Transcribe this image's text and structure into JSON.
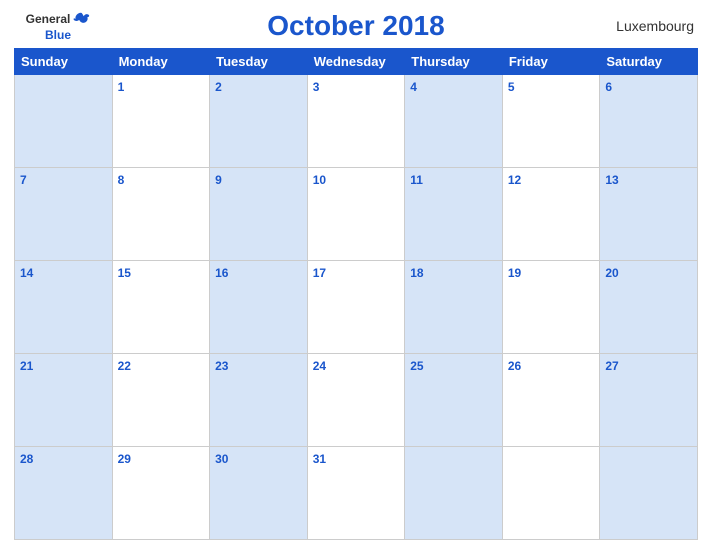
{
  "header": {
    "logo_general": "General",
    "logo_blue": "Blue",
    "title": "October 2018",
    "country": "Luxembourg"
  },
  "weekdays": [
    "Sunday",
    "Monday",
    "Tuesday",
    "Wednesday",
    "Thursday",
    "Friday",
    "Saturday"
  ],
  "weeks": [
    [
      {
        "day": "",
        "bg": "blue"
      },
      {
        "day": "1",
        "bg": "white"
      },
      {
        "day": "2",
        "bg": "blue"
      },
      {
        "day": "3",
        "bg": "white"
      },
      {
        "day": "4",
        "bg": "blue"
      },
      {
        "day": "5",
        "bg": "white"
      },
      {
        "day": "6",
        "bg": "blue"
      }
    ],
    [
      {
        "day": "7",
        "bg": "blue"
      },
      {
        "day": "8",
        "bg": "white"
      },
      {
        "day": "9",
        "bg": "blue"
      },
      {
        "day": "10",
        "bg": "white"
      },
      {
        "day": "11",
        "bg": "blue"
      },
      {
        "day": "12",
        "bg": "white"
      },
      {
        "day": "13",
        "bg": "blue"
      }
    ],
    [
      {
        "day": "14",
        "bg": "blue"
      },
      {
        "day": "15",
        "bg": "white"
      },
      {
        "day": "16",
        "bg": "blue"
      },
      {
        "day": "17",
        "bg": "white"
      },
      {
        "day": "18",
        "bg": "blue"
      },
      {
        "day": "19",
        "bg": "white"
      },
      {
        "day": "20",
        "bg": "blue"
      }
    ],
    [
      {
        "day": "21",
        "bg": "blue"
      },
      {
        "day": "22",
        "bg": "white"
      },
      {
        "day": "23",
        "bg": "blue"
      },
      {
        "day": "24",
        "bg": "white"
      },
      {
        "day": "25",
        "bg": "blue"
      },
      {
        "day": "26",
        "bg": "white"
      },
      {
        "day": "27",
        "bg": "blue"
      }
    ],
    [
      {
        "day": "28",
        "bg": "blue"
      },
      {
        "day": "29",
        "bg": "white"
      },
      {
        "day": "30",
        "bg": "blue"
      },
      {
        "day": "31",
        "bg": "white"
      },
      {
        "day": "",
        "bg": "blue"
      },
      {
        "day": "",
        "bg": "white"
      },
      {
        "day": "",
        "bg": "blue"
      }
    ]
  ]
}
